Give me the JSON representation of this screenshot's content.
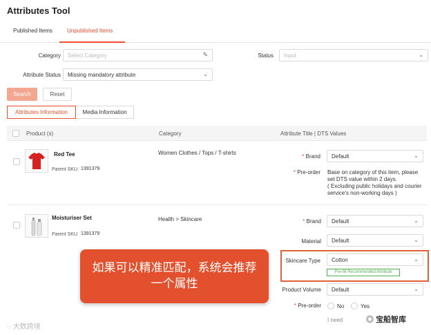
{
  "page": {
    "title": "Attributes Tool"
  },
  "tabs": [
    {
      "label": "Published Items"
    },
    {
      "label": "Unpublished Items"
    }
  ],
  "filters": {
    "category_label": "Category",
    "category_placeholder": "Select Category",
    "status_label": "Status",
    "status_placeholder": "Input",
    "attr_status_label": "Attribute Status",
    "attr_status_value": "Missing mandatory attribute"
  },
  "buttons": {
    "search": "Search",
    "reset": "Reset"
  },
  "segments": [
    {
      "label": "Attributes Information"
    },
    {
      "label": "Media Information"
    }
  ],
  "table": {
    "headers": {
      "product": "Product (s)",
      "category": "Category",
      "attribute": "Attribute Title  |  DTS Values"
    },
    "rows": [
      {
        "name": "Red Tee",
        "sku_label": "Parent SKU:",
        "sku": "1391379",
        "category": "Women Clothes / Tops / T-shirts",
        "attrs": {
          "brand_label": "Brand",
          "brand_value": "Default",
          "preorder_label": "Pre-order",
          "preorder_note": [
            "Base on category of this item, please",
            "set DTS value within 2 days.",
            "( Excluding public holidays and courier",
            "service's non-working days )"
          ]
        }
      },
      {
        "name": "Moisturiser Set",
        "sku_label": "Parent SKU:",
        "sku": "1391379",
        "category": "Health > Skincare",
        "attrs": {
          "brand_label": "Brand",
          "brand_value": "Default",
          "material_label": "Material",
          "material_value": "Default",
          "skincare_label": "Skincare Type",
          "skincare_value": "Cotton",
          "recommended_badge": "Pre-fill Recommended Attribute",
          "volume_label": "Product Volume",
          "volume_value": "Default",
          "preorder_label": "Pre-order",
          "preorder_no": "No",
          "preorder_yes": "Yes",
          "need_label": "I need"
        }
      }
    ]
  },
  "callout": {
    "line1": "如果可以精准匹配，系统会推荐",
    "line2": "一个属性"
  },
  "watermarks": {
    "left": "大数跨境",
    "right": "宝船智库"
  },
  "colors": {
    "accent": "#ee4d2d",
    "callout_bg": "#e2502d",
    "badge_green": "#4caf50"
  }
}
